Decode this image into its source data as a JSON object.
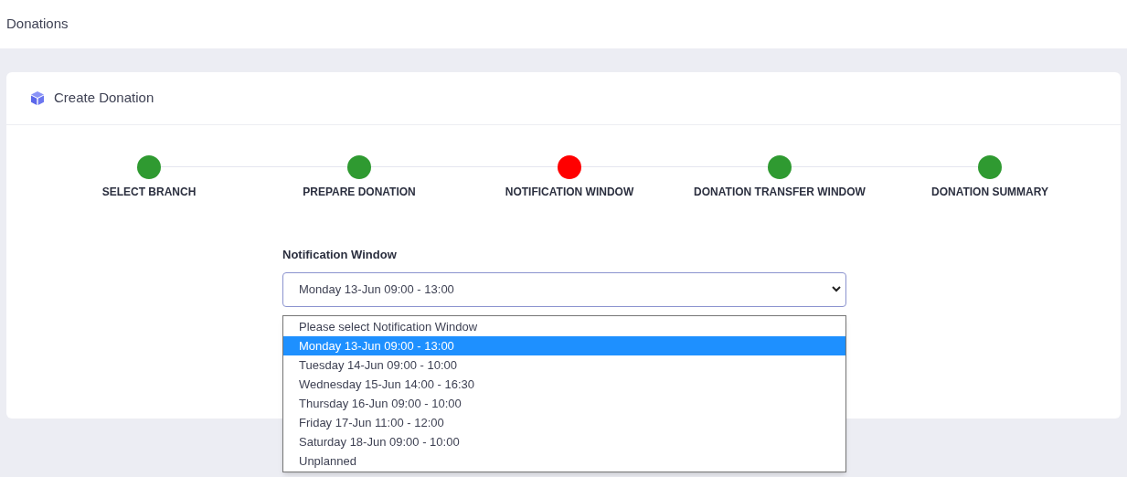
{
  "page_title": "Donations",
  "card": {
    "title": "Create Donation"
  },
  "steps": [
    {
      "label": "SELECT BRANCH",
      "color": "#2f9a31"
    },
    {
      "label": "PREPARE DONATION",
      "color": "#2f9a31"
    },
    {
      "label": "NOTIFICATION WINDOW",
      "color": "#ff0000"
    },
    {
      "label": "DONATION TRANSFER WINDOW",
      "color": "#2f9a31"
    },
    {
      "label": "DONATION SUMMARY",
      "color": "#2f9a31"
    }
  ],
  "field": {
    "label": "Notification Window",
    "value": "Monday 13-Jun 09:00 - 13:00",
    "expanded": true,
    "options": [
      {
        "label": "Please select Notification Window",
        "selected": false
      },
      {
        "label": "Monday 13-Jun 09:00 - 13:00",
        "selected": true
      },
      {
        "label": "Tuesday 14-Jun 09:00 - 10:00",
        "selected": false
      },
      {
        "label": "Wednesday 15-Jun 14:00 - 16:30",
        "selected": false
      },
      {
        "label": "Thursday 16-Jun 09:00 - 10:00",
        "selected": false
      },
      {
        "label": "Friday 17-Jun 11:00 - 12:00",
        "selected": false
      },
      {
        "label": "Saturday 18-Jun 09:00 - 10:00",
        "selected": false
      },
      {
        "label": "Unplanned",
        "selected": false
      }
    ]
  }
}
